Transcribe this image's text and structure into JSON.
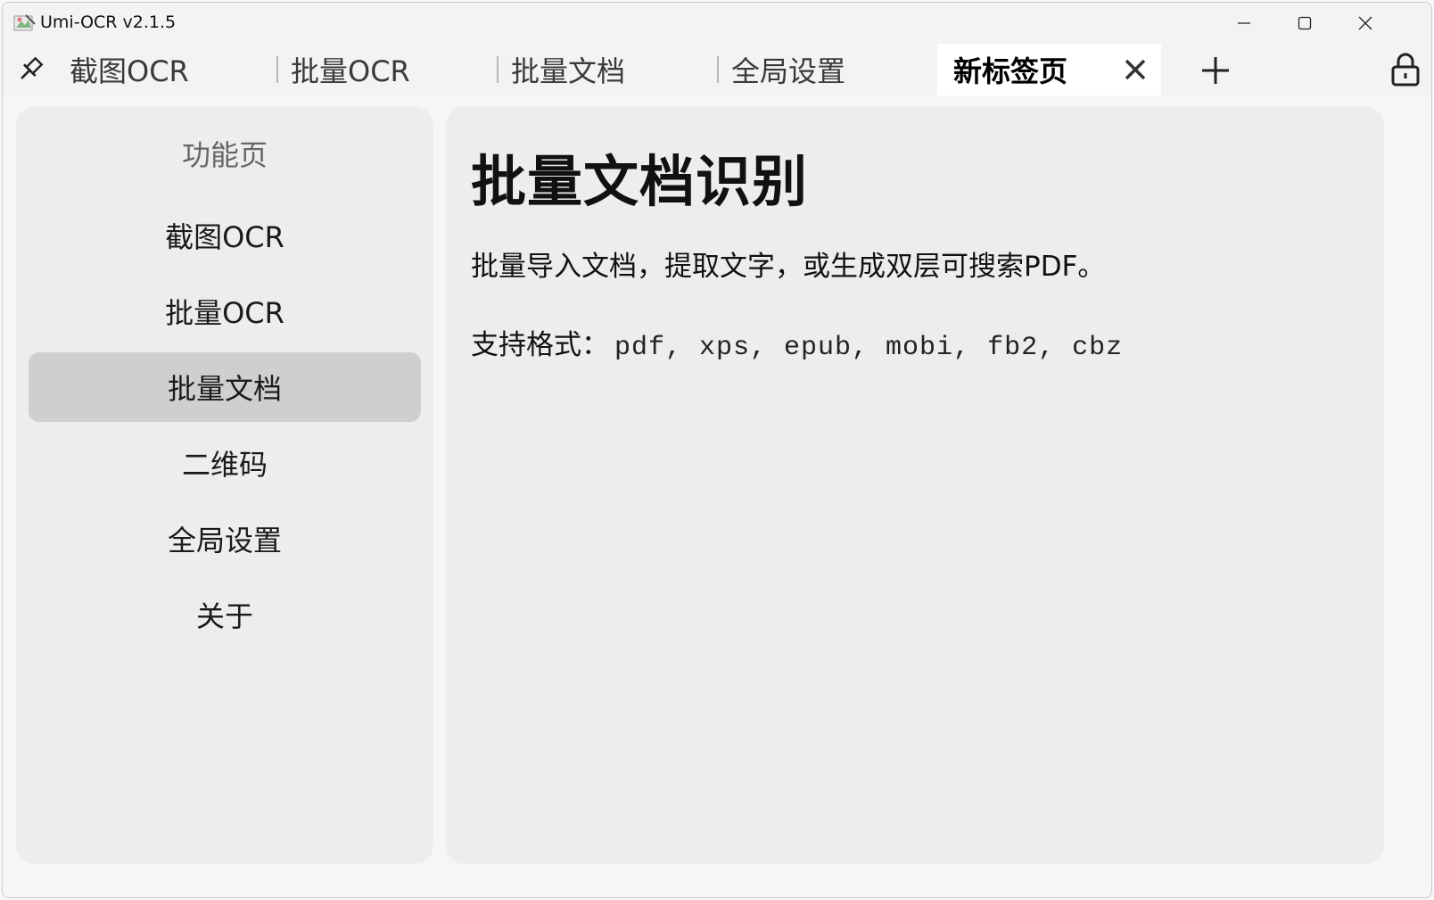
{
  "window": {
    "title": "Umi-OCR v2.1.5"
  },
  "tabs": [
    {
      "label": "截图OCR"
    },
    {
      "label": "批量OCR"
    },
    {
      "label": "批量文档"
    },
    {
      "label": "全局设置"
    },
    {
      "label": "新标签页",
      "active": true
    }
  ],
  "nav": {
    "title": "功能页",
    "items": [
      {
        "label": "截图OCR"
      },
      {
        "label": "批量OCR"
      },
      {
        "label": "批量文档",
        "selected": true
      },
      {
        "label": "二维码"
      },
      {
        "label": "全局设置"
      },
      {
        "label": "关于"
      }
    ]
  },
  "main": {
    "title": "批量文档识别",
    "description": "批量导入文档，提取文字，或生成双层可搜索PDF。",
    "formats_label": "支持格式：",
    "formats_list": "pdf, xps, epub, mobi, fb2, cbz"
  },
  "icons": {
    "app": "app-icon",
    "pin": "pin-icon",
    "tab_close": "close-icon",
    "tab_add": "plus-icon",
    "lock": "lock-icon",
    "minimize": "minimize-icon",
    "maximize": "maximize-icon",
    "close": "close-icon"
  },
  "colors": {
    "selected_nav": "#cfcfcf",
    "panel_bg": "#ededed",
    "active_tab_bg": "#ffffff"
  }
}
